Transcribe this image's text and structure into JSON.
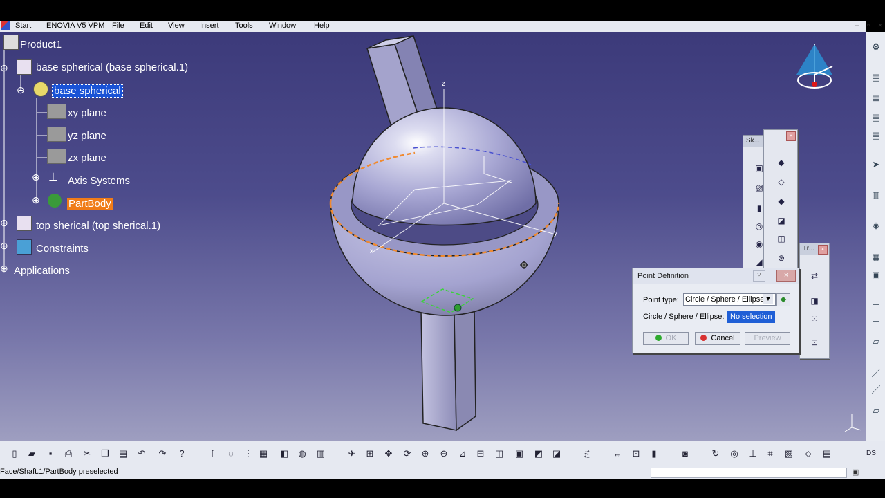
{
  "menu": {
    "items": [
      "Start",
      "ENOVIA V5 VPM",
      "File",
      "Edit",
      "View",
      "Insert",
      "Tools",
      "Window",
      "Help"
    ]
  },
  "tree": {
    "product": "Product1",
    "base_instance": "base spherical (base spherical.1)",
    "base_part": "base spherical",
    "xy_plane": "xy plane",
    "yz_plane": "yz plane",
    "zx_plane": "zx plane",
    "axis_systems": "Axis Systems",
    "partbody": "PartBody",
    "top_instance": "top sherical (top sherical.1)",
    "constraints": "Constraints",
    "applications": "Applications"
  },
  "axes": {
    "z": "z",
    "y": "y",
    "x": "x"
  },
  "palettes": {
    "sketcher_title": "Sk...",
    "transform_title": "Tr..."
  },
  "point_dialog": {
    "title": "Point Definition",
    "help": "?",
    "point_type_label": "Point type:",
    "point_type_value": "Circle / Sphere / Ellipse",
    "target_label": "Circle / Sphere / Ellipse:",
    "target_value": "No selection",
    "ok_label": "OK",
    "cancel_label": "Cancel",
    "preview_label": "Preview"
  },
  "status": {
    "text": "Face/Shaft.1/PartBody preselected",
    "command_value": ""
  },
  "colors": {
    "background_top": "#3c3a7a",
    "background_bottom": "#9e9ec0",
    "selection": "#1a53d6",
    "partbody_highlight": "#f07c17",
    "sphere": "#b4b3dc",
    "edge_highlight": "#f08a30"
  }
}
